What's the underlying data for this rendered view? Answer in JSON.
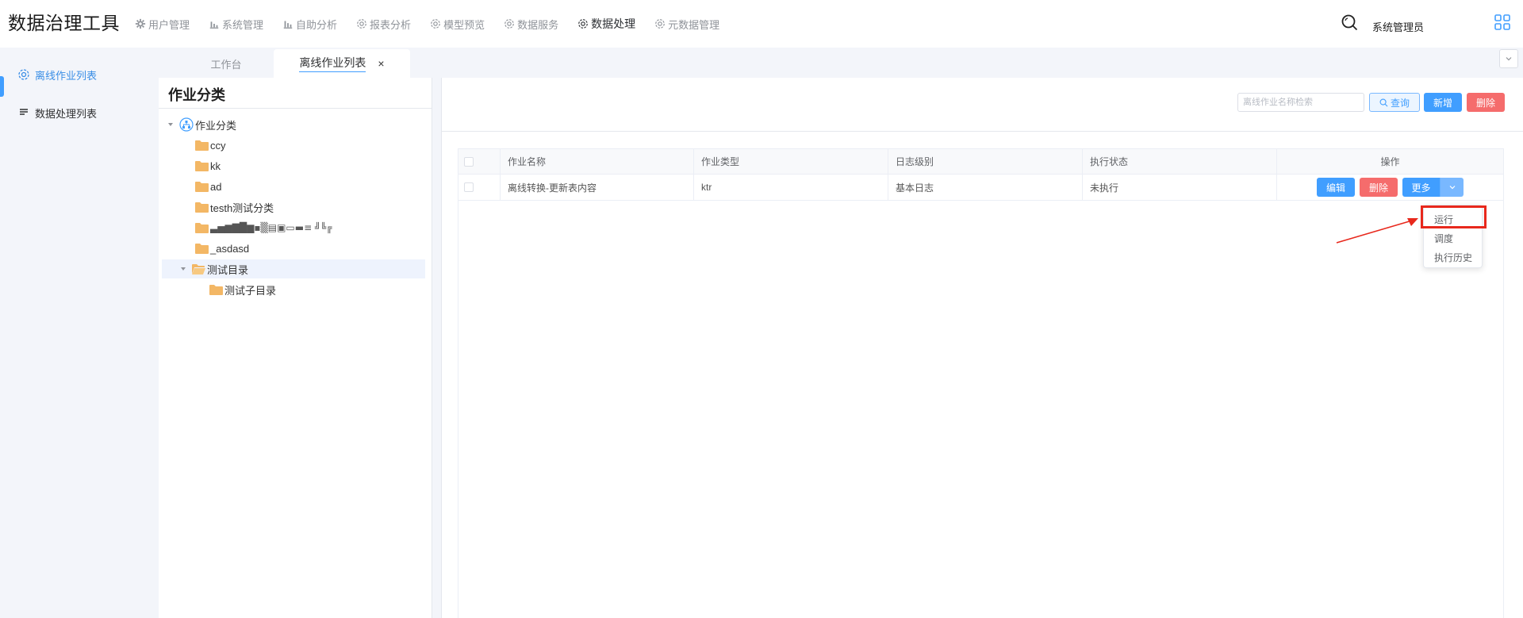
{
  "app": {
    "title": "数据治理工具"
  },
  "nav": {
    "items": [
      {
        "label": "用户管理",
        "icon": "gear-icon"
      },
      {
        "label": "系统管理",
        "icon": "bar-chart-icon"
      },
      {
        "label": "自助分析",
        "icon": "bar-chart-icon"
      },
      {
        "label": "报表分析",
        "icon": "gear-icon"
      },
      {
        "label": "模型预览",
        "icon": "gear-icon"
      },
      {
        "label": "数据服务",
        "icon": "gear-icon"
      },
      {
        "label": "数据处理",
        "icon": "gear-icon",
        "active": true
      },
      {
        "label": "元数据管理",
        "icon": "gear-icon"
      }
    ]
  },
  "user": {
    "name": "系统管理员"
  },
  "sidebar": {
    "items": [
      {
        "label": "离线作业列表",
        "icon": "gear-icon",
        "active": true
      },
      {
        "label": "数据处理列表",
        "icon": "list-icon"
      }
    ]
  },
  "tabs": [
    {
      "label": "工作台"
    },
    {
      "label": "离线作业列表",
      "active": true,
      "close": "×"
    }
  ],
  "category": {
    "title": "作业分类",
    "root": "作业分类",
    "nodes": [
      {
        "label": "ccy"
      },
      {
        "label": "kk"
      },
      {
        "label": "ad"
      },
      {
        "label": "testh测试分类"
      },
      {
        "label": "▃▅▆▇█▆▪▒▤▣▭▬≡ ╝╚╔"
      },
      {
        "label": "_asdasd"
      },
      {
        "label": "测试目录",
        "expanded": true,
        "selected": true
      },
      {
        "label": "测试子目录"
      }
    ]
  },
  "toolbar": {
    "search_placeholder": "离线作业名称检索",
    "query_label": "查询",
    "add_label": "新增",
    "delete_label": "删除"
  },
  "table": {
    "headers": [
      "作业名称",
      "作业类型",
      "日志级别",
      "执行状态",
      "操作"
    ],
    "rows": [
      {
        "name": "离线转换-更新表内容",
        "type": "ktr",
        "log_level": "基本日志",
        "status": "未执行"
      }
    ],
    "actions": {
      "edit": "编辑",
      "delete": "删除",
      "more": "更多"
    }
  },
  "more_menu": {
    "items": [
      "运行",
      "调度",
      "执行历史"
    ]
  },
  "colors": {
    "primary": "#409eff",
    "danger": "#f56c6c",
    "highlight": "#e8281c",
    "background": "#f3f5fa"
  }
}
